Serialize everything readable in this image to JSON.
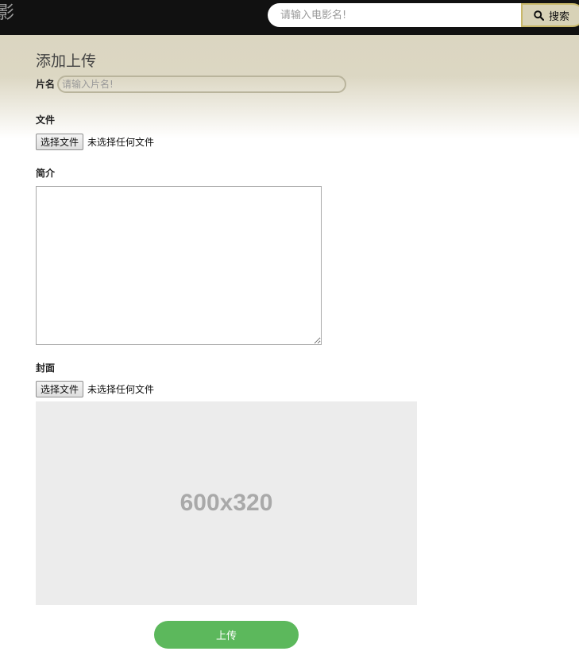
{
  "header": {
    "logo_text": "影",
    "search_placeholder": "请输入电影名!",
    "search_button_label": "搜索",
    "search_icon": "search-icon"
  },
  "form": {
    "title": "添加上传",
    "name_label": "片名",
    "name_placeholder": "请输入片名!",
    "file_label": "文件",
    "file_button_label": "选择文件",
    "file_status": "未选择任何文件",
    "intro_label": "简介",
    "intro_value": "",
    "cover_label": "封面",
    "cover_button_label": "选择文件",
    "cover_status": "未选择任何文件",
    "cover_placeholder_text": "600x320",
    "submit_label": "上传"
  },
  "colors": {
    "topbar": "#111111",
    "accent_green": "#5cb85c",
    "band": "#dbd6c1"
  }
}
